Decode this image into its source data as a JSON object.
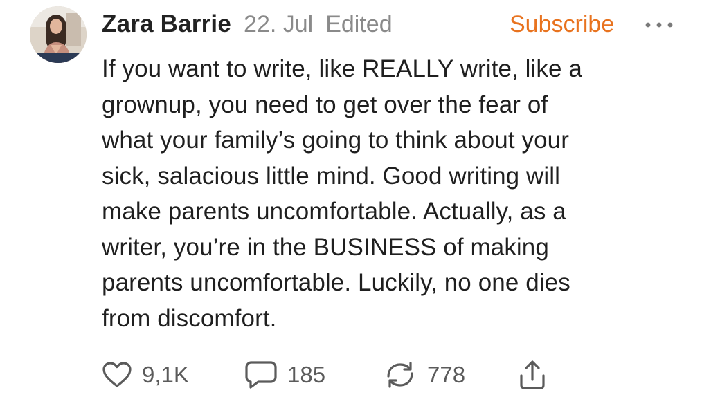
{
  "post": {
    "author": "Zara Barrie",
    "date": "22. Jul",
    "edited_label": "Edited",
    "subscribe_label": "Subscribe",
    "body": "If you want to write, like REALLY write, like a\ngrownup, you need to get over the fear of\nwhat your family’s going to think about your\nsick, salacious little mind. Good writing will\nmake parents uncomfortable. Actually, as a\nwriter, you’re in the BUSINESS of making\nparents uncomfortable. Luckily, no one dies\nfrom discomfort.",
    "actions": {
      "likes": "9,1K",
      "comments": "185",
      "restacks": "778"
    }
  },
  "icons": {
    "like": "heart-icon",
    "comment": "comment-bubble-icon",
    "restack": "restack-icon",
    "share": "share-icon",
    "more": "more-dots-icon"
  },
  "colors": {
    "accent": "#e8731f",
    "text": "#1f1f1f",
    "muted": "#8a8a8a",
    "icon": "#5b5b5b"
  }
}
